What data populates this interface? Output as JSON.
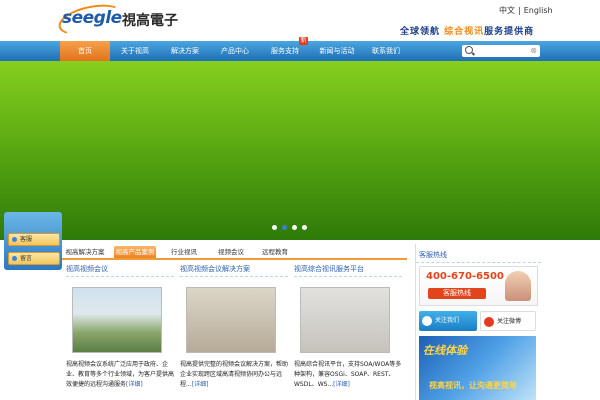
{
  "header": {
    "logo_text": "seegle",
    "logo_cn": "視高電子",
    "lang": {
      "cn": "中文",
      "en": "English"
    },
    "tagline_a": "全球领航",
    "tagline_b": "综合视讯",
    "tagline_c": "服务提供商"
  },
  "nav": {
    "items": [
      "首页",
      "关于视高",
      "解决方案",
      "产品中心",
      "服务支持",
      "新闻与活动",
      "联系我们"
    ],
    "badge": "新"
  },
  "search": {
    "placeholder": ""
  },
  "banner": {
    "slides": 4,
    "current": 2
  },
  "sidepanel": {
    "items": [
      "客服",
      "留言"
    ]
  },
  "tabs": [
    "视高解决方案",
    "视高产品案例",
    "行业视讯",
    "视频会议",
    "远程教育"
  ],
  "columns": [
    {
      "title": "视高视频会议",
      "desc": "视高视频会议系统广泛应用于政府、企业、教育等多个行业领域，为客户提供高效便捷的远程沟通服务",
      "more": "[详细]"
    },
    {
      "title": "视高视频会议解决方案",
      "desc": "视高提供完整的视频会议解决方案，帮助企业实现跨区域高清视频协同办公与远程...",
      "more": "[详细]"
    },
    {
      "title": "视高综合视讯服务平台",
      "desc": "视高综合视讯平台，支持SOA/WOA等多种架构，兼容OSGi、SOAP、REST、WSDL、WS...",
      "more": "[详细]"
    }
  ],
  "right": {
    "title": "客服热线",
    "hotline": "400-670-6500",
    "hotline_label": "客服热线",
    "follow1": "关注我们",
    "follow2": "关注微博",
    "online_title": "在线体验",
    "online_sub": "视高视讯，让沟通更简单"
  }
}
